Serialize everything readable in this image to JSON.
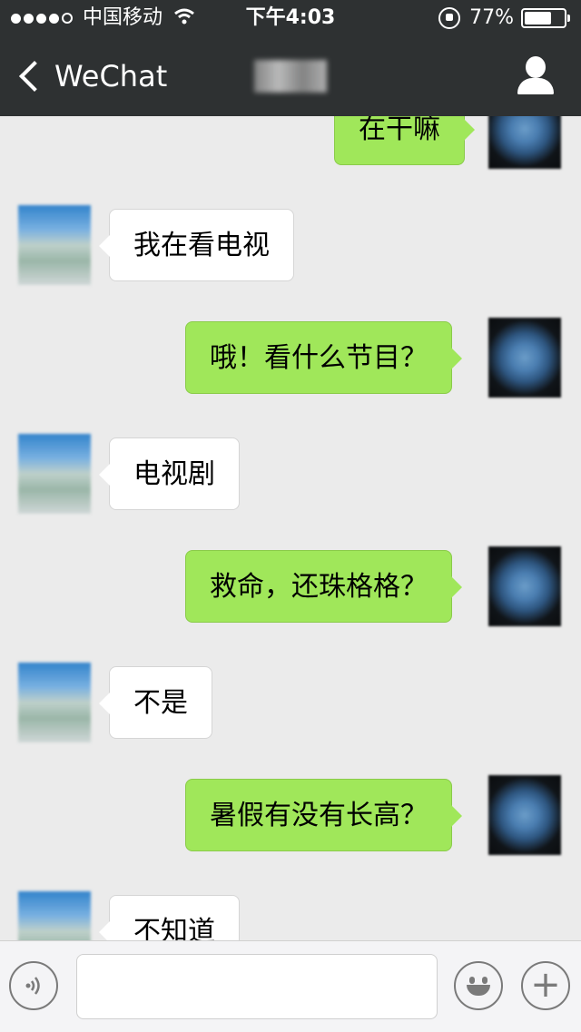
{
  "status_bar": {
    "carrier": "中国移动",
    "time": "下午4:03",
    "battery_text": "77%",
    "battery_level": 0.77,
    "signal_bars_filled": 4,
    "signal_bars_total": 5
  },
  "nav": {
    "back_label": "WeChat",
    "icons": {
      "back": "chevron-left-icon",
      "profile": "person-icon"
    }
  },
  "messages": [
    {
      "sender": "me",
      "text": "在干嘛"
    },
    {
      "sender": "them",
      "text": "我在看电视"
    },
    {
      "sender": "me",
      "text": "哦！看什么节目？"
    },
    {
      "sender": "them",
      "text": "电视剧"
    },
    {
      "sender": "me",
      "text": "救命，还珠格格？"
    },
    {
      "sender": "them",
      "text": "不是"
    },
    {
      "sender": "me",
      "text": "暑假有没有长高？"
    },
    {
      "sender": "them",
      "text": "不知道"
    }
  ],
  "input_bar": {
    "icons": {
      "voice": "voice-icon",
      "emoji": "emoji-icon",
      "more": "plus-icon"
    }
  },
  "colors": {
    "nav_bg": "#2e3132",
    "chat_bg": "#ebebeb",
    "my_bubble": "#a0e75a",
    "their_bubble": "#ffffff"
  }
}
